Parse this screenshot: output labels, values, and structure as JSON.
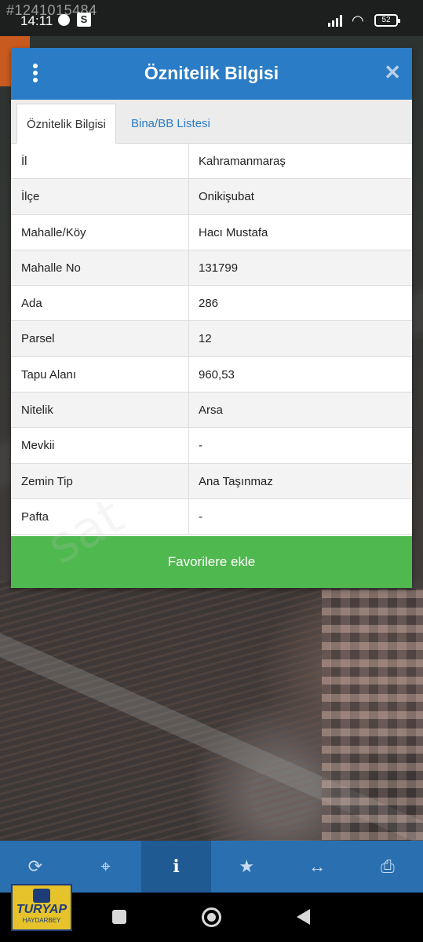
{
  "status_bar": {
    "overlay_id": "#1241015484",
    "time": "14:11",
    "battery": "52"
  },
  "dialog": {
    "title": "Öznitelik Bilgisi",
    "close_icon": "close-icon",
    "menu_icon": "more-vertical-icon",
    "tabs": [
      {
        "label": "Öznitelik Bilgisi",
        "active": true
      },
      {
        "label": "Bina/BB Listesi",
        "active": false
      }
    ],
    "rows": [
      {
        "label": "İl",
        "value": "Kahramanmaraş"
      },
      {
        "label": "İlçe",
        "value": "Onikişubat"
      },
      {
        "label": "Mahalle/Köy",
        "value": "Hacı Mustafa"
      },
      {
        "label": "Mahalle No",
        "value": "131799"
      },
      {
        "label": "Ada",
        "value": "286"
      },
      {
        "label": "Parsel",
        "value": "12"
      },
      {
        "label": "Tapu Alanı",
        "value": "960,53"
      },
      {
        "label": "Nitelik",
        "value": "Arsa"
      },
      {
        "label": "Mevkii",
        "value": "-"
      },
      {
        "label": "Zemin Tip",
        "value": "Ana Taşınmaz"
      },
      {
        "label": "Pafta",
        "value": "-"
      }
    ],
    "favorite_button": "Favorilere ekle"
  },
  "watermark": "sat",
  "toolbar": {
    "items": [
      {
        "icon": "refresh-icon",
        "active": false
      },
      {
        "icon": "locate-icon",
        "active": false
      },
      {
        "icon": "info-icon",
        "active": true
      },
      {
        "icon": "star-icon",
        "active": false
      },
      {
        "icon": "measure-icon",
        "active": false
      },
      {
        "icon": "print-icon",
        "active": false
      }
    ]
  },
  "logo": {
    "name": "TURYAP",
    "sub": "HAYDARBEY"
  },
  "colors": {
    "header": "#2a7cc6",
    "favorite": "#4fb84f",
    "toolbar": "#2a6fb0"
  }
}
